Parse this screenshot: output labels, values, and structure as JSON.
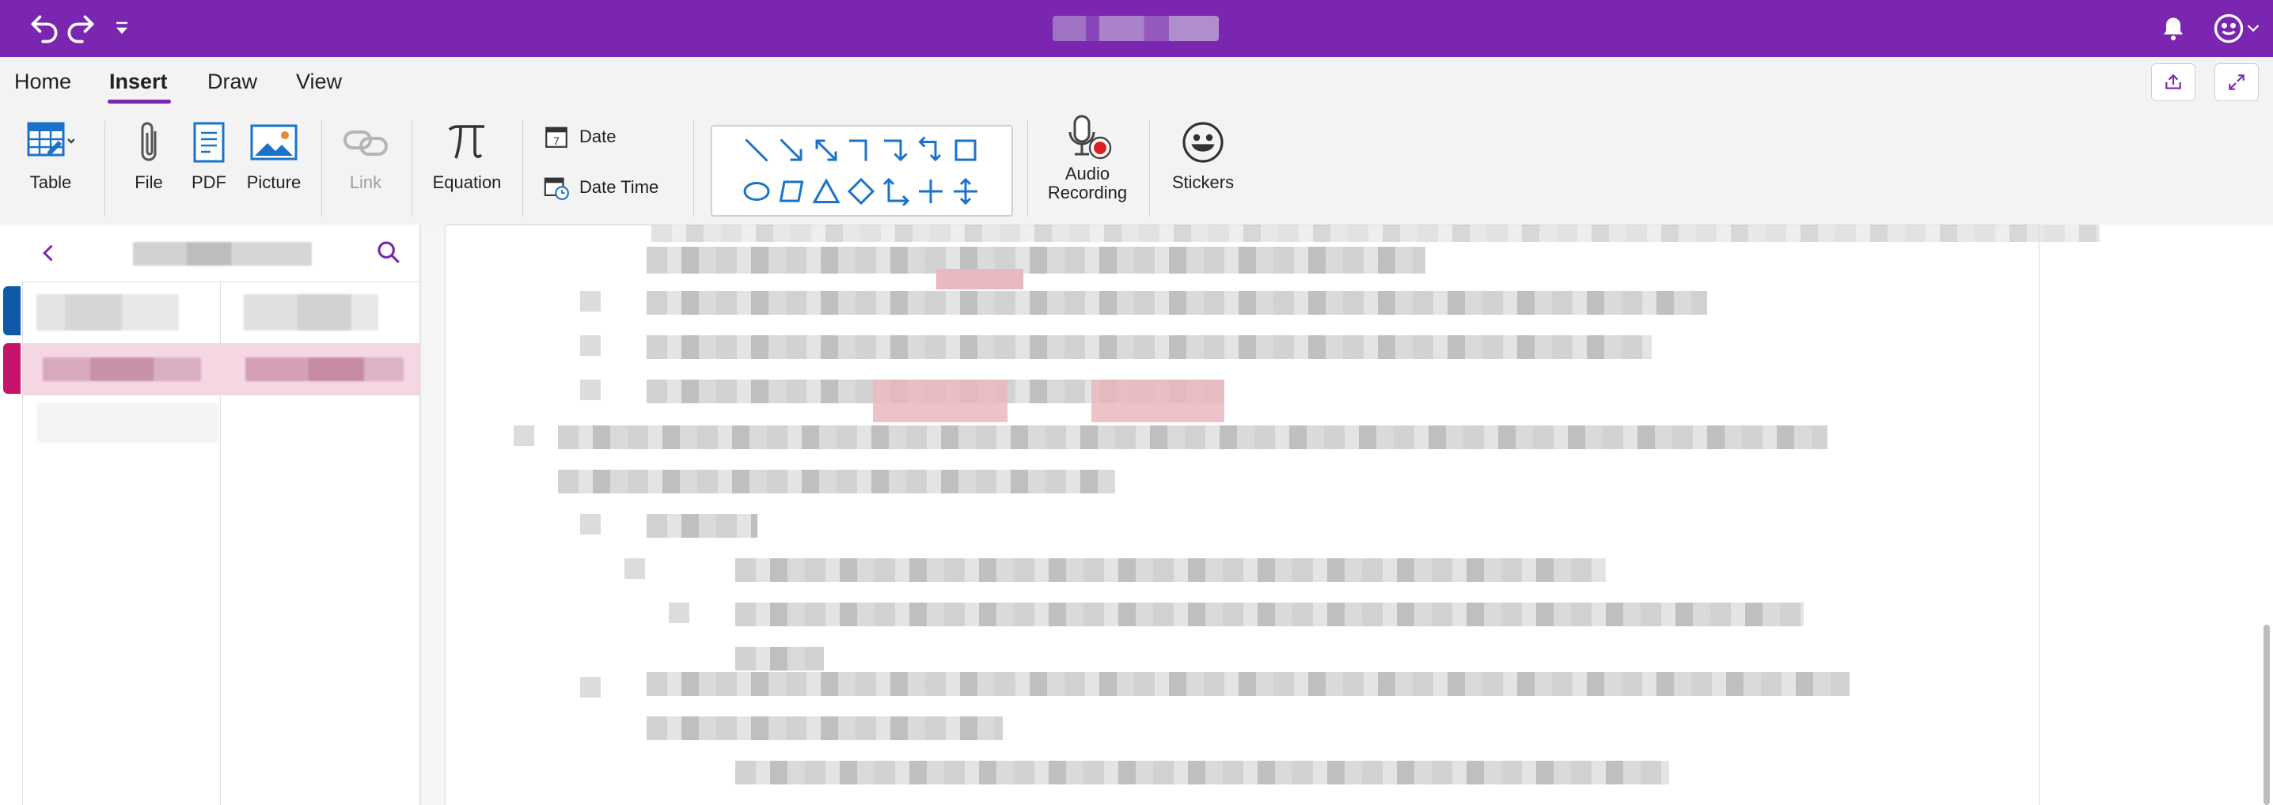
{
  "titlebar": {
    "undo_icon": "undo-icon",
    "redo_icon": "redo-icon",
    "customize_icon": "chevron-down-icon",
    "bell_icon": "bell-icon",
    "account_icon": "smiley-icon"
  },
  "tabs": [
    {
      "label": "Home"
    },
    {
      "label": "Insert"
    },
    {
      "label": "Draw"
    },
    {
      "label": "View"
    }
  ],
  "ribbon": {
    "table": "Table",
    "file": "File",
    "pdf": "PDF",
    "picture": "Picture",
    "link": "Link",
    "equation": "Equation",
    "date": "Date",
    "date_time": "Date  Time",
    "audio_line1": "Audio",
    "audio_line2": "Recording",
    "stickers": "Stickers"
  },
  "colors": {
    "accent": "#7a26b0",
    "shape_blue": "#1a73c9",
    "section_blue": "#0f5aa6",
    "section_pink": "#c8136b"
  }
}
